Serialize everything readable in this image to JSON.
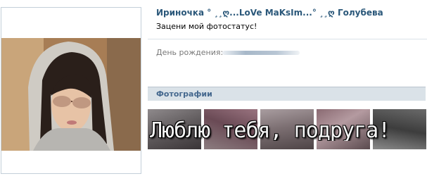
{
  "profile": {
    "name": "Ириночка ° ¸¸ღ...LoVe MaKsIm...° ¸¸ღ Голубева",
    "status": "Зацени мой фотостатус!",
    "birthday_label": "День рождения:"
  },
  "photos": {
    "header": "Фотографии",
    "banner_text": "Люблю тебя, подруга!",
    "thumbnails": [
      {
        "name": "photo-1"
      },
      {
        "name": "photo-2"
      },
      {
        "name": "photo-3"
      },
      {
        "name": "photo-4"
      },
      {
        "name": "photo-5"
      }
    ]
  },
  "colors": {
    "name_link": "#2b587a",
    "section_header_bg": "#dae2e8",
    "section_header_text": "#45688e",
    "divider": "#dae1e8",
    "label_gray": "#777777"
  }
}
